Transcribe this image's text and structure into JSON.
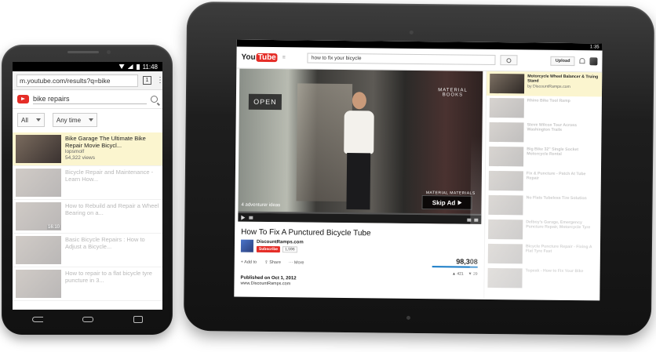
{
  "phone": {
    "status_time": "11:48",
    "url": "m.youtube.com/results?q=bike",
    "tab_count": "1",
    "search_query": "bike repairs",
    "filter_type": "All",
    "filter_time": "Any time",
    "results": [
      {
        "title": "Bike Garage The Ultimate Bike Repair Movie Bicycl...",
        "channel": "lopsmolf",
        "views": "54,322 views",
        "duration": "",
        "active": true
      },
      {
        "title": "Bicycle Repair and Maintenance - Learn How...",
        "channel": "",
        "views": "",
        "duration": "",
        "active": false
      },
      {
        "title": "How to Rebuild and Repair a Wheel Bearing on a...",
        "channel": "",
        "views": "",
        "duration": "16:10",
        "active": false
      },
      {
        "title": "Basic Bicycle Repairs : How to Adjust a Bicycle...",
        "channel": "",
        "views": "",
        "duration": "",
        "active": false
      },
      {
        "title": "How to repair to a flat bicycle tyre puncture in 3...",
        "channel": "",
        "views": "",
        "duration": "",
        "active": false
      }
    ]
  },
  "tablet": {
    "status_time": "1:35",
    "logo_you": "You",
    "logo_tube": "Tube",
    "search_query": "how to fix your bicycle",
    "upload_label": "Upload",
    "video": {
      "sign_text": "OPEN",
      "window_text": "MATERIAL BOOKS",
      "caption_left": "4 adventurer ideas",
      "caption_right": "MATERIAL MATERIALS",
      "skip_ad_label": "Skip Ad",
      "title": "How To Fix A Punctured Bicycle Tube",
      "channel": "DiscountRamps.com",
      "subscribe_label": "Subscribe",
      "subscriber_count": "1,596",
      "views": "98,308",
      "add_to_label": "Add to",
      "share_label": "Share",
      "more_label": "More",
      "likes": "421",
      "dislikes": "29",
      "published": "Published on Oct 1, 2012",
      "publisher_url": "www.DiscountRamps.com"
    },
    "related": [
      {
        "title": "Motorcycle Wheel Balancer & Truing Stand",
        "channel": "by DiscountRamps.com",
        "views": "",
        "active": true
      },
      {
        "title": "Rhino Bike Tool Ramp",
        "channel": "",
        "views": "",
        "active": false
      },
      {
        "title": "Steve Wilcox Tour Across Washington Trails",
        "channel": "",
        "views": "",
        "active": false
      },
      {
        "title": "Big Bike 32\" Single Socket Motorcycle Rental",
        "channel": "",
        "views": "",
        "active": false
      },
      {
        "title": "Fix & Puncture - Patch At Tube Repair",
        "channel": "",
        "views": "",
        "active": false
      },
      {
        "title": "No Flats Tubeless Tire Solution",
        "channel": "",
        "views": "",
        "active": false
      },
      {
        "title": "Delboy's Garage, Emergency Puncture Repair, Motorcycle Tyre",
        "channel": "",
        "views": "",
        "active": false
      },
      {
        "title": "Bicycle Puncture Repair - Fixing A Flat Tyre Fast",
        "channel": "",
        "views": "",
        "active": false
      },
      {
        "title": "Topeak - How to Fix Your Bike",
        "channel": "",
        "views": "",
        "active": false
      }
    ]
  }
}
